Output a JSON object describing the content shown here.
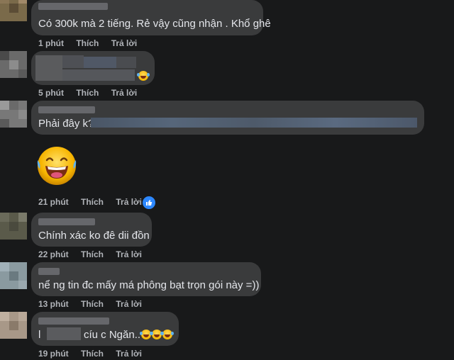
{
  "comments": [
    {
      "text": "Có 300k mà 2 tiếng. Rẻ vậy cũng nhận . Khổ ghê",
      "time": "1 phút",
      "like": "Thích",
      "reply": "Trả lời"
    },
    {
      "text": "",
      "time": "5 phút",
      "like": "Thích",
      "reply": "Trả lời"
    },
    {
      "text": "Phải đây k?",
      "time": "21 phút",
      "like": "Thích",
      "reply": "Trả lời"
    },
    {
      "text": "Chính xác ko đê dii đồn",
      "time": "22 phút",
      "like": "Thích",
      "reply": "Trả lời"
    },
    {
      "text": "nể ng tin đc mấy má phông bạt trọn gói này =))",
      "time": "13 phút",
      "like": "Thích",
      "reply": "Trả lời"
    },
    {
      "text_prefix": "l",
      "text": "cíu c Ngăn..",
      "time": "19 phút",
      "like": "Thích",
      "reply": "Trả lời"
    }
  ],
  "icons": {
    "laugh": "laughing-tears-emoji-icon",
    "like": "like-reaction-icon"
  },
  "colors": {
    "background": "#18191a",
    "bubble": "#3a3b3c",
    "meta_text": "#b0b3b8",
    "like_blue": "#2d88ff"
  }
}
